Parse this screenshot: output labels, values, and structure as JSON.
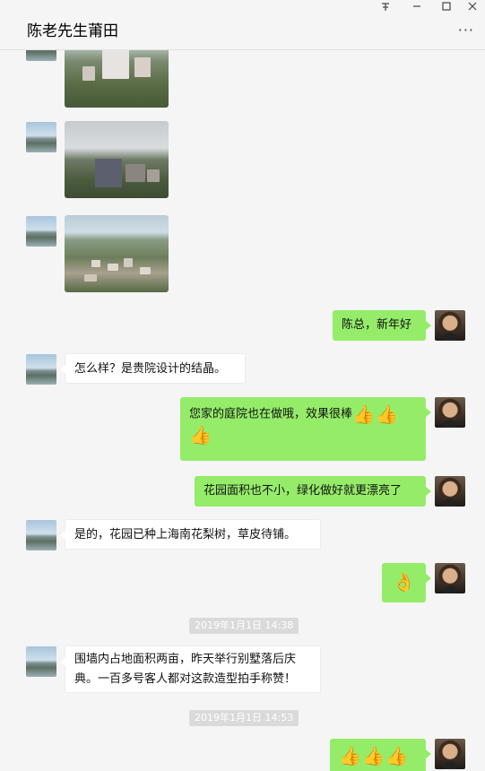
{
  "window": {
    "title": "陈老先生莆田",
    "pin_icon": "pin-icon",
    "minimize_icon": "minimize-icon",
    "maximize_icon": "maximize-icon",
    "close_icon": "close-icon",
    "more_icon": "more-icon",
    "more_symbol": "···"
  },
  "messages": [
    {
      "id": "m1",
      "side": "left",
      "type": "image",
      "avatar": "landscape-avatar"
    },
    {
      "id": "m2",
      "side": "left",
      "type": "image",
      "avatar": "landscape-avatar"
    },
    {
      "id": "m3",
      "side": "left",
      "type": "image",
      "avatar": "landscape-avatar"
    },
    {
      "id": "m4",
      "side": "right",
      "type": "text",
      "text": "陈总，新年好",
      "avatar": "person-avatar"
    },
    {
      "id": "m5",
      "side": "left",
      "type": "text",
      "text": "怎么样？是贵院设计的结晶。",
      "avatar": "landscape-avatar"
    },
    {
      "id": "m6",
      "side": "right",
      "type": "text",
      "text": "您家的庭院也在做哦，效果很棒",
      "emoji": [
        "thumbs-up",
        "thumbs-up",
        "thumbs-up"
      ],
      "avatar": "person-avatar"
    },
    {
      "id": "m7",
      "side": "right",
      "type": "text",
      "text": "花园面积也不小，绿化做好就更漂亮了",
      "avatar": "person-avatar"
    },
    {
      "id": "m8",
      "side": "left",
      "type": "text",
      "text": "是的，花园已种上海南花梨树，草皮待铺。",
      "avatar": "landscape-avatar"
    },
    {
      "id": "m9",
      "side": "right",
      "type": "emoji",
      "emoji": [
        "ok-hand"
      ],
      "avatar": "person-avatar"
    },
    {
      "id": "t1",
      "type": "timestamp",
      "text": "2019年1月1日 14:38"
    },
    {
      "id": "m10",
      "side": "left",
      "type": "text",
      "text_line1": "围墙内占地面积两亩，昨天举行别墅落后庆",
      "text_line2": "典。一百多号客人都对这款造型拍手称赞！",
      "avatar": "landscape-avatar"
    },
    {
      "id": "t2",
      "type": "timestamp",
      "text": "2019年1月1日 14:53"
    },
    {
      "id": "m11",
      "side": "right",
      "type": "emoji",
      "emoji": [
        "thumbs-up",
        "thumbs-up",
        "thumbs-up"
      ],
      "avatar": "person-avatar"
    }
  ],
  "glyphs": {
    "thumbs_up": "👍",
    "ok_hand": "👌"
  },
  "colors": {
    "bubble_self": "#95ec69",
    "bubble_other": "#ffffff",
    "background": "#f5f5f5",
    "timestamp_bg": "#dadada"
  }
}
